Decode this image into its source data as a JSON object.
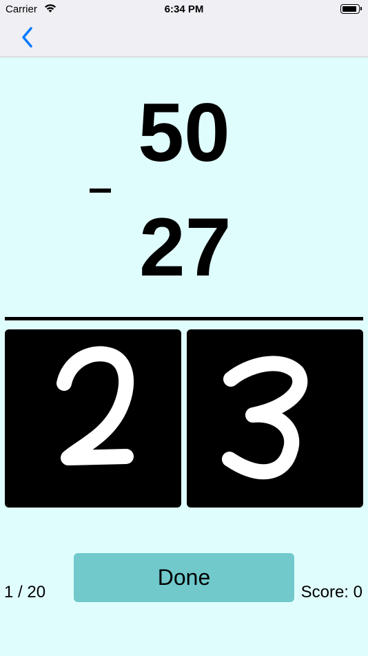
{
  "status_bar": {
    "carrier": "Carrier",
    "time": "6:34 PM"
  },
  "nav": {
    "back_icon": "chevron-left-icon"
  },
  "problem": {
    "top_number": "50",
    "operator": "-",
    "bottom_number": "27"
  },
  "answer_pads": [
    {
      "digit": "2"
    },
    {
      "digit": "3"
    }
  ],
  "footer": {
    "progress": "1 / 20",
    "done_label": "Done",
    "score": "Score: 0"
  },
  "colors": {
    "background": "#e0fdfd",
    "bar": "#efeff4",
    "accent": "#007aff",
    "done_button": "#71c9cc"
  }
}
